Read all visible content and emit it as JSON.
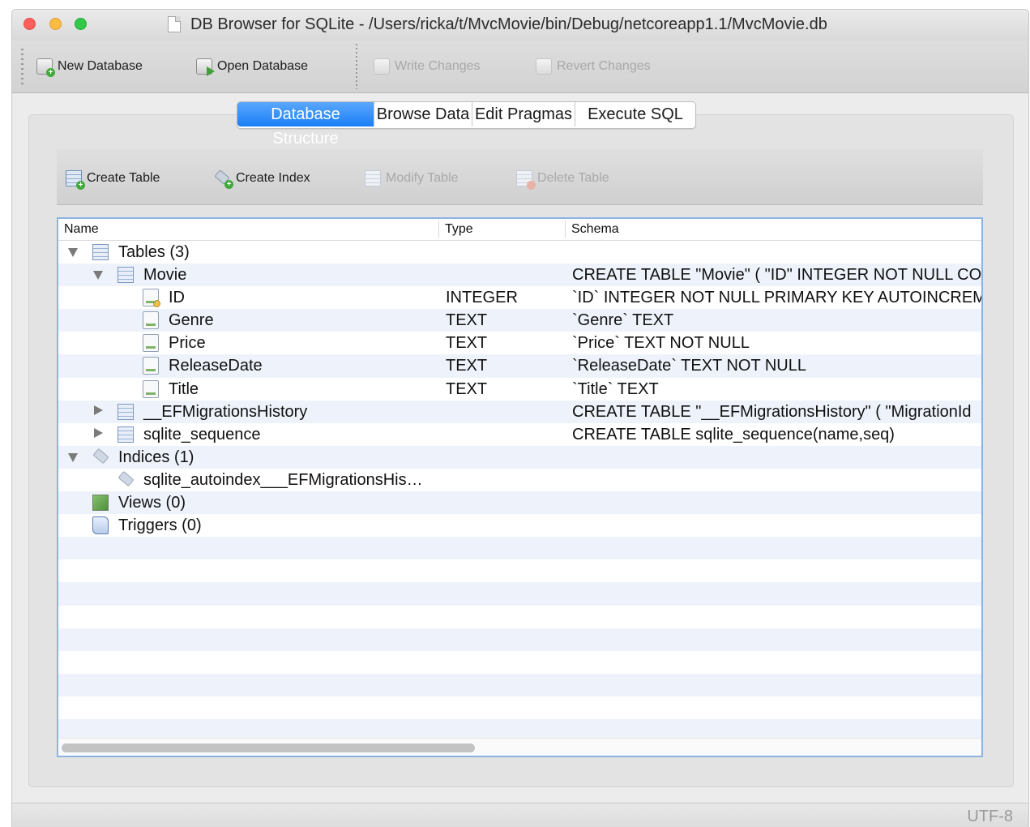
{
  "window": {
    "title": "DB Browser for SQLite - /Users/ricka/t/MvcMovie/bin/Debug/netcoreapp1.1/MvcMovie.db"
  },
  "toolbar": {
    "new_database": "New Database",
    "open_database": "Open Database",
    "write_changes": "Write Changes",
    "revert_changes": "Revert Changes"
  },
  "tabs": {
    "database_structure": "Database Structure",
    "browse_data": "Browse Data",
    "edit_pragmas": "Edit Pragmas",
    "execute_sql": "Execute SQL",
    "active": "Database Structure",
    "accent_color": "#1a7ff5"
  },
  "structure_toolbar": {
    "create_table": "Create Table",
    "create_index": "Create Index",
    "modify_table": "Modify Table",
    "delete_table": "Delete Table"
  },
  "tree": {
    "headers": {
      "name": "Name",
      "type": "Type",
      "schema": "Schema"
    },
    "rows": [
      {
        "name": "Tables (3)",
        "type": "",
        "schema": "",
        "icon": "table-group-icon",
        "expanded": true
      },
      {
        "name": "Movie",
        "type": "",
        "schema": "CREATE TABLE \"Movie\" ( \"ID\" INTEGER NOT NULL CO",
        "icon": "table-icon",
        "expanded": true
      },
      {
        "name": "ID",
        "type": "INTEGER",
        "schema": "`ID` INTEGER NOT NULL PRIMARY KEY AUTOINCREM",
        "icon": "primary-key-field-icon"
      },
      {
        "name": "Genre",
        "type": "TEXT",
        "schema": "`Genre` TEXT",
        "icon": "field-icon"
      },
      {
        "name": "Price",
        "type": "TEXT",
        "schema": "`Price` TEXT NOT NULL",
        "icon": "field-icon"
      },
      {
        "name": "ReleaseDate",
        "type": "TEXT",
        "schema": "`ReleaseDate` TEXT NOT NULL",
        "icon": "field-icon"
      },
      {
        "name": "Title",
        "type": "TEXT",
        "schema": "`Title` TEXT",
        "icon": "field-icon"
      },
      {
        "name": "__EFMigrationsHistory",
        "type": "",
        "schema": "CREATE TABLE \"__EFMigrationsHistory\" ( \"MigrationId",
        "icon": "table-icon",
        "expanded": false
      },
      {
        "name": "sqlite_sequence",
        "type": "",
        "schema": "CREATE TABLE sqlite_sequence(name,seq)",
        "icon": "table-icon",
        "expanded": false
      },
      {
        "name": "Indices (1)",
        "type": "",
        "schema": "",
        "icon": "index-group-icon",
        "expanded": true
      },
      {
        "name": "sqlite_autoindex___EFMigrationsHis…",
        "type": "",
        "schema": "",
        "icon": "index-icon"
      },
      {
        "name": "Views (0)",
        "type": "",
        "schema": "",
        "icon": "views-icon"
      },
      {
        "name": "Triggers (0)",
        "type": "",
        "schema": "",
        "icon": "triggers-icon"
      }
    ]
  },
  "status": {
    "encoding": "UTF-8"
  }
}
